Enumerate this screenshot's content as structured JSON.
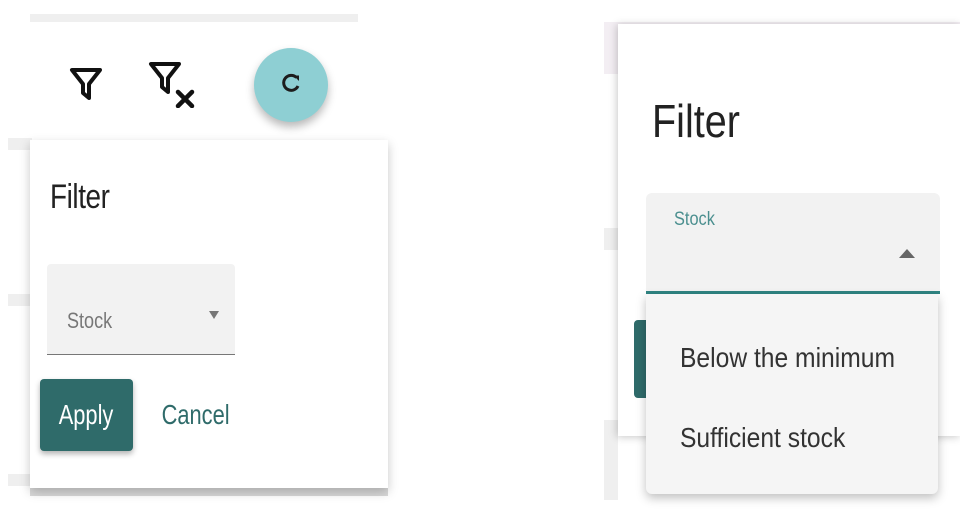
{
  "left_panel": {
    "toolbar": {
      "filter_icon": "filter-icon",
      "clear_filter_icon": "filter-clear-icon",
      "refresh_icon": "refresh-icon"
    },
    "dialog": {
      "title": "Filter",
      "select": {
        "placeholder": "Stock"
      },
      "apply_label": "Apply",
      "cancel_label": "Cancel"
    }
  },
  "right_panel": {
    "dialog": {
      "title": "Filter",
      "select": {
        "label": "Stock",
        "options": [
          "Below the minimum",
          "Sufficient stock"
        ]
      }
    }
  },
  "colors": {
    "primary": "#2f6b6a",
    "accent_fab": "#8ecfd3",
    "focus_underline": "#2f8482",
    "field_bg": "#f2f2f2"
  }
}
